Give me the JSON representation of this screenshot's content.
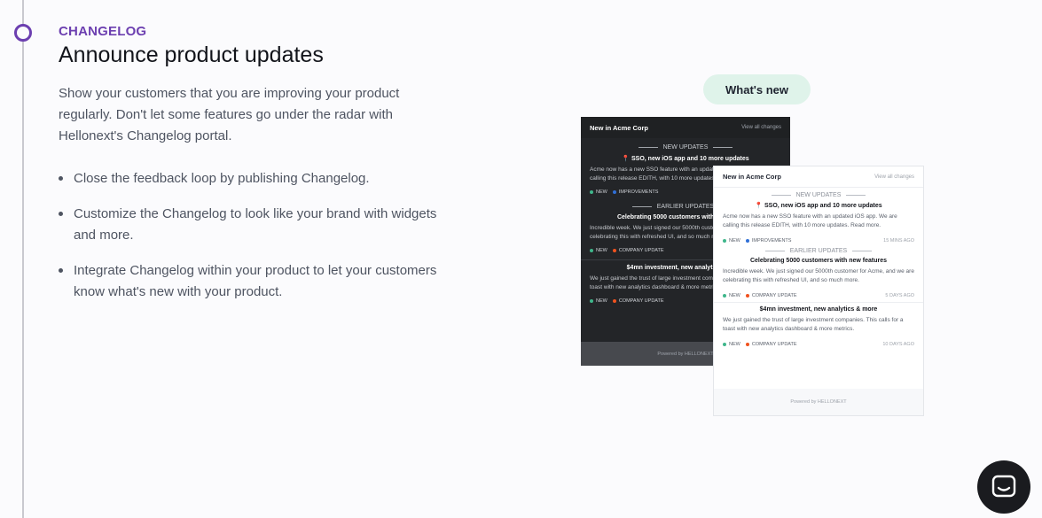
{
  "section": {
    "eyebrow": "CHANGELOG",
    "title": "Announce product updates",
    "description": "Show your customers that you are improving your product regularly. Don't let some features go under the radar with Hellonext's Changelog portal.",
    "bullets": [
      "Close the feedback loop by publishing Changelog.",
      "Customize the Changelog to look like your brand with widgets and more.",
      "Integrate Changelog within your product to let your customers know what's new with your product."
    ]
  },
  "preview": {
    "pill_label": "What's new",
    "dark_card": {
      "brand": "New in Acme Corp",
      "view_all": "View all changes",
      "new_updates_label": "NEW UPDATES",
      "earlier_updates_label": "EARLIER UPDATES",
      "posts": [
        {
          "title": "📍 SSO, new iOS app and 10 more updates",
          "body": "Acme now has a new SSO feature with an updated iOS app. We are calling this release EDITH, with 10 more updates.",
          "tags": [
            "NEW",
            "IMPROVEMENTS"
          ]
        },
        {
          "title": "Celebrating 5000 customers with new features",
          "body": "Incredible week. We just signed our 5000th customer for Acme, and we are celebrating this with refreshed UI, and so much more.",
          "tags": [
            "NEW",
            "COMPANY UPDATE"
          ]
        },
        {
          "title": "$4mn investment, new analytics & more",
          "body": "We just gained the trust of large investment companies. This calls for a toast with new analytics dashboard & more metrics.",
          "tags": [
            "NEW",
            "COMPANY UPDATE"
          ]
        }
      ],
      "footer_prefix": "Powered by",
      "footer_brand": "HELLONEXT"
    },
    "light_card": {
      "brand": "New in Acme Corp",
      "view_all": "View all changes",
      "new_updates_label": "NEW UPDATES",
      "earlier_updates_label": "EARLIER UPDATES",
      "posts": [
        {
          "title": "📍 SSO, new iOS app and 10 more updates",
          "body": "Acme now has a new SSO feature with an updated iOS app. We are calling this release EDITH, with 10 more updates. Read more.",
          "tags": [
            "NEW",
            "IMPROVEMENTS"
          ],
          "time": "15 MINS AGO"
        },
        {
          "title": "Celebrating 5000 customers with new features",
          "body": "Incredible week. We just signed our 5000th customer for Acme, and we are celebrating this with refreshed UI, and so much more.",
          "tags": [
            "NEW",
            "COMPANY UPDATE"
          ],
          "time": "5 DAYS AGO"
        },
        {
          "title": "$4mn investment, new analytics & more",
          "body": "We just gained the trust of large investment companies. This calls for a toast with new analytics dashboard & more metrics.",
          "tags": [
            "NEW",
            "COMPANY UPDATE"
          ],
          "time": "10 DAYS AGO"
        }
      ],
      "footer_prefix": "Powered by",
      "footer_brand": "HELLONEXT"
    },
    "tag_colors": {
      "NEW": "#3fb68b",
      "IMPROVEMENTS": "#2f6fd6",
      "COMPANY UPDATE": "#f0521e"
    }
  },
  "chat_widget": {
    "icon": "chat-bubble-icon"
  },
  "colors": {
    "accent": "#6c3fb0",
    "pill_bg": "#dff3ea"
  }
}
